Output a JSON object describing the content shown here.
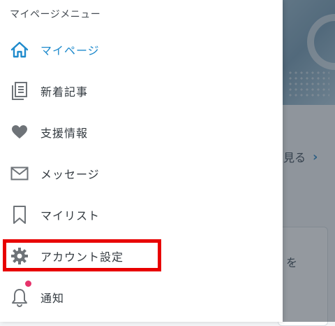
{
  "menu": {
    "title": "マイページメニュー",
    "items": [
      {
        "label": "マイページ",
        "icon": "home-icon",
        "active": true
      },
      {
        "label": "新着記事",
        "icon": "articles-icon"
      },
      {
        "label": "支援情報",
        "icon": "heart-icon"
      },
      {
        "label": "メッセージ",
        "icon": "mail-icon"
      },
      {
        "label": "マイリスト",
        "icon": "bookmark-icon"
      },
      {
        "label": "アカウント設定",
        "icon": "gear-icon",
        "highlighted": true
      },
      {
        "label": "通知",
        "icon": "bell-icon",
        "has_badge": true
      }
    ]
  },
  "background": {
    "more_link": "見る",
    "card_text": "を"
  },
  "colors": {
    "accent": "#1e8acc",
    "highlight": "#e80000",
    "badge": "#e6336b",
    "icon_gray": "#6e7378"
  }
}
